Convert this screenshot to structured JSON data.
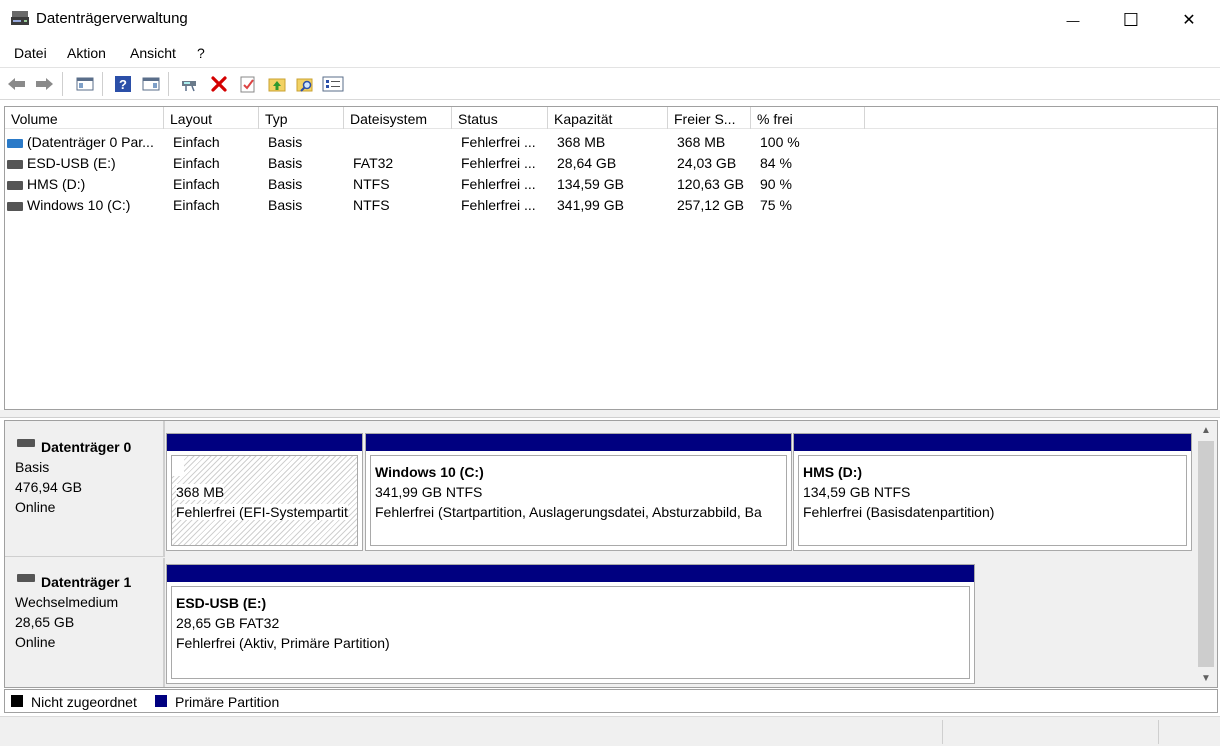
{
  "window": {
    "title": "Datenträgerverwaltung",
    "minimize_glyph": "—",
    "maximize_glyph": "☐",
    "close_glyph": "✕"
  },
  "menu": {
    "items": [
      {
        "label": "Datei"
      },
      {
        "label": "Aktion"
      },
      {
        "label": "Ansicht"
      },
      {
        "label": "?"
      }
    ]
  },
  "toolbar": {
    "buttons": [
      {
        "icon": "back-arrow-icon",
        "enabled": false
      },
      {
        "icon": "forward-arrow-icon",
        "enabled": false
      },
      {
        "icon": "show-hide-console-tree-icon"
      },
      {
        "icon": "help-icon"
      },
      {
        "icon": "properties-pane-icon"
      },
      {
        "icon": "connect-drive-icon"
      },
      {
        "icon": "delete-icon"
      },
      {
        "icon": "check-disk-icon"
      },
      {
        "icon": "format-folder-icon"
      },
      {
        "icon": "search-folder-icon"
      },
      {
        "icon": "settings-icon"
      }
    ]
  },
  "volume_list": {
    "columns": [
      "Volume",
      "Layout",
      "Typ",
      "Dateisystem",
      "Status",
      "Kapazität",
      "Freier S...",
      "% frei"
    ],
    "rows": [
      {
        "volume": "(Datenträger 0 Par...",
        "layout": "Einfach",
        "typ": "Basis",
        "dateisystem": "",
        "status": "Fehlerfrei ...",
        "kapazitaet": "368 MB",
        "frei": "368 MB",
        "prozent": "100 %",
        "icon_color": "#2a7ac8"
      },
      {
        "volume": "ESD-USB (E:)",
        "layout": "Einfach",
        "typ": "Basis",
        "dateisystem": "FAT32",
        "status": "Fehlerfrei ...",
        "kapazitaet": "28,64 GB",
        "frei": "24,03 GB",
        "prozent": "84 %",
        "icon_color": "#555555"
      },
      {
        "volume": "HMS (D:)",
        "layout": "Einfach",
        "typ": "Basis",
        "dateisystem": "NTFS",
        "status": "Fehlerfrei ...",
        "kapazitaet": "134,59 GB",
        "frei": "120,63 GB",
        "prozent": "90 %",
        "icon_color": "#555555"
      },
      {
        "volume": "Windows 10 (C:)",
        "layout": "Einfach",
        "typ": "Basis",
        "dateisystem": "NTFS",
        "status": "Fehlerfrei ...",
        "kapazitaet": "341,99 GB",
        "frei": "257,12 GB",
        "prozent": "75 %",
        "icon_color": "#555555"
      }
    ]
  },
  "disks": [
    {
      "name": "Datenträger 0",
      "type": "Basis",
      "size": "476,94 GB",
      "state": "Online",
      "partitions": [
        {
          "title": "",
          "size_fs": "368 MB",
          "status": "Fehlerfrei (EFI-Systempartit",
          "hatched": true
        },
        {
          "title": "Windows 10  (C:)",
          "size_fs": "341,99 GB NTFS",
          "status": "Fehlerfrei (Startpartition, Auslagerungsdatei, Absturzabbild, Ba",
          "hatched": false
        },
        {
          "title": "HMS  (D:)",
          "size_fs": "134,59 GB NTFS",
          "status": "Fehlerfrei (Basisdatenpartition)",
          "hatched": false
        }
      ]
    },
    {
      "name": "Datenträger 1",
      "type": "Wechselmedium",
      "size": "28,65 GB",
      "state": "Online",
      "partitions": [
        {
          "title": "ESD-USB  (E:)",
          "size_fs": "28,65 GB FAT32",
          "status": "Fehlerfrei (Aktiv, Primäre Partition)",
          "hatched": false
        }
      ]
    }
  ],
  "legend": [
    {
      "label": "Nicht zugeordnet",
      "color": "#000000"
    },
    {
      "label": "Primäre Partition",
      "color": "#000080"
    }
  ],
  "colors": {
    "partition_bar": "#000080",
    "delete_red": "#d40000"
  }
}
